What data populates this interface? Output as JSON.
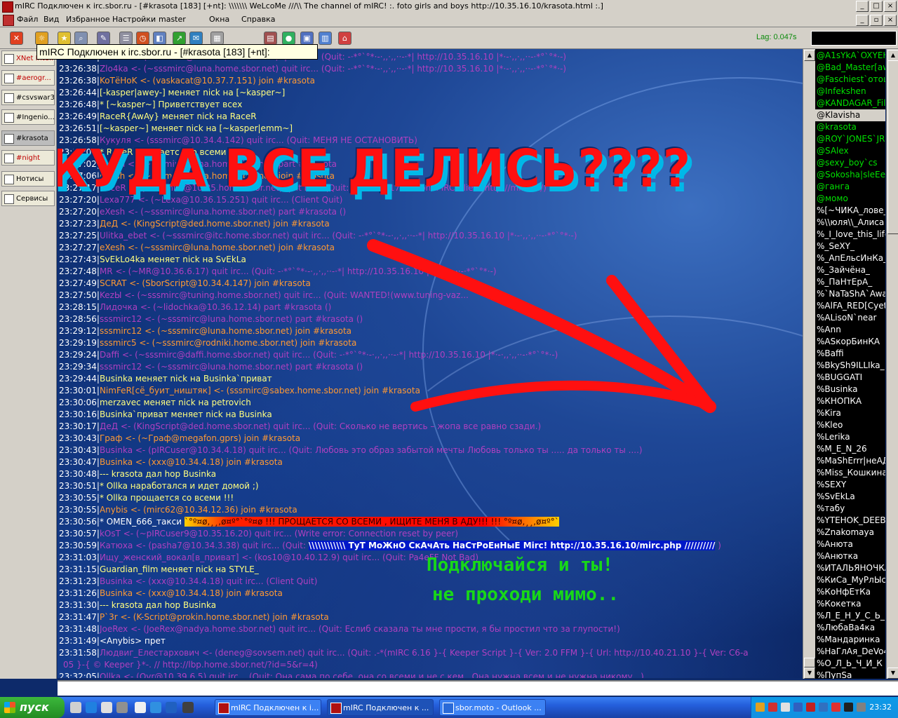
{
  "window": {
    "title": "mIRC Подключен к irc.sbor.ru - [#krasota [183] [+nt]: \\\\\\\\\\\\\\ WeLcoMe ///\\\\ The channel of mIRC! :. foto girls and boys http://10.35.16.10/krasota.html :.]",
    "tooltip": "mIRC Подключен к irc.sbor.ru - [#krasota [183] [+nt]:",
    "lag": "Lag: 0.047s"
  },
  "menu": [
    "Файл",
    "Вид",
    "Избранное",
    "Настройки",
    "master",
    "Окна",
    "Справка"
  ],
  "switchbar": [
    {
      "label": "XNet Inte...",
      "color": "#c00000"
    },
    {
      "label": "#aerogr...",
      "color": "#c00000"
    },
    {
      "label": "#csvswar3",
      "color": "#000000"
    },
    {
      "label": "#Ingenio...",
      "color": "#000000"
    },
    {
      "label": "#krasota",
      "color": "#000000"
    },
    {
      "label": "#night",
      "color": "#c00000"
    },
    {
      "label": "Нотисы",
      "color": "#000000"
    },
    {
      "label": "Сервисы",
      "color": "#000000"
    }
  ],
  "chat": [
    {
      "ts": "23:26:36|",
      "segs": [
        {
          "t": "Zlo4ka <- (~sssmirc@luna.home.sbor.net) quit irc... (Quit: -·*°`°*·-·,,·,,··-·*| http://10.35.16.10 |*·-·,,·,,··-·*°`°*·-)",
          "c": "p"
        }
      ]
    },
    {
      "ts": "23:26:38|",
      "segs": [
        {
          "t": "Zlo4ka <- (~sssmirc@luna.home.sbor.net) quit irc... (Quit: -·*°`°*·-·,,·,,··-·*| http://10.35.16.10 |*·-·,,·,,··-·*°`°*·-)",
          "c": "p"
        }
      ]
    },
    {
      "ts": "23:26:38|",
      "segs": [
        {
          "t": "KoTёHoK <- (vaskacat@10.37.7.151) join #krasota",
          "c": "o"
        }
      ]
    },
    {
      "ts": "23:26:44|",
      "segs": [
        {
          "t": "[-kasper|awey-] меняет nick на [~kasper~]",
          "c": "y"
        }
      ]
    },
    {
      "ts": "23:26:48|",
      "segs": [
        {
          "t": "* [~kasper~] Приветствует всех",
          "c": "y"
        }
      ]
    },
    {
      "ts": "23:26:49|",
      "segs": [
        {
          "t": "RaceR{AwAy} меняет nick на RaceR",
          "c": "y"
        }
      ]
    },
    {
      "ts": "23:26:51|",
      "segs": [
        {
          "t": "[~kasper~] меняет nick на [~kasper|emm~]",
          "c": "y"
        }
      ]
    },
    {
      "ts": "23:26:58|",
      "segs": [
        {
          "t": "Кукуля <- (sssmirc@10.34.4.142) quit irc... (Quit: МЕНЯ НЕ ОСТАНОВИТЬ)",
          "c": "p"
        }
      ]
    },
    {
      "ts": "23:27:00|",
      "segs": [
        {
          "t": "* RaceR прощается со всеми !!!",
          "c": "y"
        }
      ]
    },
    {
      "ts": "23:27:02|",
      "segs": [
        {
          "t": "eXesh <- (~sssmirc@luna.home.sbor.net) part #krasota",
          "c": "p"
        }
      ]
    },
    {
      "ts": "23:27:06|",
      "segs": [
        {
          "t": "eXesh <- (~sssmirc@luna.home.sbor.net) join #krasota",
          "c": "o"
        }
      ]
    },
    {
      "ts": "23:27:17|",
      "segs": [
        {
          "t": "RaceR <- (~sssmirc@10.35.home.sbor.net) quit irc... (Quit: mIRC v6.17 Personal IRC Client http://mirc.ru/)",
          "c": "p"
        }
      ]
    },
    {
      "ts": "23:27:20|",
      "segs": [
        {
          "t": "Lexa777 <- (~Lexa@10.36.15.251) quit irc... (Client Quit)",
          "c": "p"
        }
      ]
    },
    {
      "ts": "23:27:20|",
      "segs": [
        {
          "t": "eXesh <- (~sssmirc@luna.home.sbor.net) part #krasota ()",
          "c": "p"
        }
      ]
    },
    {
      "ts": "23:27:23|",
      "segs": [
        {
          "t": "ДеД <- (KingScript@ded.home.sbor.net) join #krasota",
          "c": "o"
        }
      ]
    },
    {
      "ts": "23:27:25|",
      "segs": [
        {
          "t": "Ulitka_ebet <- (~sssmirc@itc.home.sbor.net) quit irc... (Quit: -·*°`°*·-·,,·,,··-·*| http://10.35.16.10 |*·-·,,·,,··-·*°`°*·-)",
          "c": "p"
        }
      ]
    },
    {
      "ts": "23:27:27|",
      "segs": [
        {
          "t": "eXesh <- (~sssmirc@luna.home.sbor.net) join #krasota",
          "c": "o"
        }
      ]
    },
    {
      "ts": "23:27:43|",
      "segs": [
        {
          "t": "SvEkLo4ka меняет nick на SvEkLa",
          "c": "y"
        }
      ]
    },
    {
      "ts": "23:27:48|",
      "segs": [
        {
          "t": "MR <- (~MR@10.36.6.17) quit irc... (Quit: -·*°`°*·-·,,·,,··-·*| http://10.35.16.10 |*·-·,,·,,··-·*°`°*·-)",
          "c": "p"
        }
      ]
    },
    {
      "ts": "23:27:49|",
      "segs": [
        {
          "t": "SCRAT <- (SborScript@10.34.4.147) join #krasota",
          "c": "o"
        }
      ]
    },
    {
      "ts": "23:27:50|",
      "segs": [
        {
          "t": "KezЫ <- (~sssmirc@tuning.home.sbor.net) quit irc... (Quit: WANTED!(www.tuning-vaz...",
          "c": "p"
        }
      ]
    },
    {
      "ts": "23:28:15|",
      "segs": [
        {
          "t": "Лидочка <- (~lidochka@10.36.12.14) part #krasota ()",
          "c": "p"
        }
      ]
    },
    {
      "ts": "23:28:56|",
      "segs": [
        {
          "t": "sssmirc12 <- (~sssmirc@luna.home.sbor.net) part #krasota ()",
          "c": "p"
        }
      ]
    },
    {
      "ts": "23:29:12|",
      "segs": [
        {
          "t": "sssmirc12 <- (~sssmirc@luna.home.sbor.net) join #krasota",
          "c": "o"
        }
      ]
    },
    {
      "ts": "23:29:19|",
      "segs": [
        {
          "t": "sssmirc5 <- (~sssmirc@rodniki.home.sbor.net) join #krasota",
          "c": "o"
        }
      ]
    },
    {
      "ts": "23:29:24|",
      "segs": [
        {
          "t": "Daffi <- (~sssmirc@daffi.home.sbor.net) quit irc... (Quit: -·*°`°*·-·,,·,,··-·*| http://10.35.16.10 |*·-·,,·,,··-·*°`°*·-)",
          "c": "p"
        }
      ]
    },
    {
      "ts": "23:29:34|",
      "segs": [
        {
          "t": "sssmirc12 <- (~sssmirc@luna.home.sbor.net) part #krasota ()",
          "c": "p"
        }
      ]
    },
    {
      "ts": "23:29:44|",
      "segs": [
        {
          "t": "Businka меняет nick на Businka`приват",
          "c": "y"
        }
      ]
    },
    {
      "ts": "23:30:01|",
      "segs": [
        {
          "t": "NimFeR[cё_буит_ништяк] <- (sssmirc@sabex.home.sbor.net) join #krasota",
          "c": "o"
        }
      ]
    },
    {
      "ts": "23:30:06|",
      "segs": [
        {
          "t": "merzavec меняет nick на petrovich",
          "c": "y"
        }
      ]
    },
    {
      "ts": "23:30:16|",
      "segs": [
        {
          "t": "Businka`приват меняет nick на Businka",
          "c": "y"
        }
      ]
    },
    {
      "ts": "23:30:17|",
      "segs": [
        {
          "t": "ДеД <- (KingScript@ded.home.sbor.net) quit irc... (Quit: Сколько не вертись – жопа все равно сзади.)",
          "c": "p"
        }
      ]
    },
    {
      "ts": "23:30:43|",
      "segs": [
        {
          "t": "Граф <- (~Граф@megafon.gprs) join #krasota",
          "c": "o"
        }
      ]
    },
    {
      "ts": "23:30:43|",
      "segs": [
        {
          "t": "Businka <- (pIRCuser@10.34.4.18) quit irc... (Quit: Любовь это образ забытой мечты Любовь только ты ..... да только ты ....)",
          "c": "p"
        }
      ]
    },
    {
      "ts": "23:30:47|",
      "segs": [
        {
          "t": "Businka <- (xxx@10.34.4.18) join #krasota",
          "c": "o"
        }
      ]
    },
    {
      "ts": "23:30:48|",
      "segs": [
        {
          "t": "--- krasota дал hop Businka",
          "c": "y"
        }
      ]
    },
    {
      "ts": "23:30:51|",
      "segs": [
        {
          "t": "* Ollka наработался и идет домой ;)",
          "c": "y"
        }
      ]
    },
    {
      "ts": "23:30:55|",
      "segs": [
        {
          "t": "* Ollka прощается со всеми !!!",
          "c": "y"
        }
      ]
    },
    {
      "ts": "23:30:55|",
      "segs": [
        {
          "t": "Anybis <- (mirc62@10.34.12.36) join #krasota",
          "c": "o"
        }
      ]
    },
    {
      "ts": "23:30:56|",
      "segs": [
        {
          "t": "* OMEN_666_такси ",
          "c": "w"
        },
        {
          "t": "`°º¤ø,¸¸,ø¤º°`°º¤ø !!! ПРОЩАЕТСЯ СО ВСЕМИ , ИЩИТЕ МЕНЯ В АДУ!!! !!! °º¤ø,¸¸,ø¤º°`",
          "c": "hl"
        }
      ]
    },
    {
      "ts": "23:30:57|",
      "segs": [
        {
          "t": "kOsT <- (~pIRCuser9@10.35.16.20) quit irc... (Write error: Connection reset by peer)",
          "c": "p"
        }
      ]
    },
    {
      "ts": "23:30:59|",
      "segs": [
        {
          "t": "Катюха <- (pasha7@10.34.3.38) quit irc... (Quit: ",
          "c": "p"
        },
        {
          "t": "\\\\\\\\\\\\\\\\\\\\\\\\  ТуТ МоЖнО СкАчАть НаСтРоЕнНыЕ Mirc! http://10.35.16.10/mirc.php  //////////",
          "c": "bar"
        },
        {
          "t": " )",
          "c": "p"
        }
      ]
    },
    {
      "ts": "23:31:03|",
      "segs": [
        {
          "t": "Ищу_женский_вокал[в_приват] <- (kos10@10.40.12.9) quit irc... (Quit: Pa4eFF Not Bad)",
          "c": "p"
        }
      ]
    },
    {
      "ts": "23:31:15|",
      "segs": [
        {
          "t": "Guardian_film меняет nick на STYLE_",
          "c": "y"
        }
      ]
    },
    {
      "ts": "23:31:23|",
      "segs": [
        {
          "t": "Businka <- (xxx@10.34.4.18) quit irc... (Client Quit)",
          "c": "p"
        }
      ]
    },
    {
      "ts": "23:31:26|",
      "segs": [
        {
          "t": "Businka <- (xxx@10.34.4.18) join #krasota",
          "c": "o"
        }
      ]
    },
    {
      "ts": "23:31:30|",
      "segs": [
        {
          "t": "--- krasota дал hop Businka",
          "c": "y"
        }
      ]
    },
    {
      "ts": "23:31:47|",
      "segs": [
        {
          "t": "P`3r <- (K-Script@prokin.home.sbor.net) join #krasota",
          "c": "o"
        }
      ]
    },
    {
      "ts": "23:31:48|",
      "segs": [
        {
          "t": "JoeRex <- (JoeRex@nadya.home.sbor.net) quit irc... (Quit: Еслиб сказала ты мне прости, я бы простил что за глупости!)",
          "c": "p"
        }
      ]
    },
    {
      "ts": "23:31:49|",
      "segs": [
        {
          "t": "<Anybis> прет",
          "c": "w"
        }
      ]
    },
    {
      "ts": "23:31:58|",
      "segs": [
        {
          "t": "Людвиг_Елестархович <- (deneg@sovsem.net) quit irc... (Quit: .-*(mIRC 6.16 }-{ Keeper Script }-{ Ver: 2.0 FFM }-{ Url: http://10.40.21.10 }-{ Ver: C6-a",
          "c": "p"
        }
      ]
    },
    {
      "ts": "",
      "segs": [
        {
          "t": "05 }-{ © Keeper }*-. // http://lbp.home.sbor.net/?id=5&r=4)",
          "c": "p"
        }
      ]
    },
    {
      "ts": "23:32:05|",
      "segs": [
        {
          "t": "Ollka <- (Ovr@10.39.6.5) quit irc... (Quit: Она сама по себе, она со всеми и не с кем...Она нужна всем и не нужна никому...)",
          "c": "p"
        }
      ]
    }
  ],
  "overlay": {
    "headline": "КУДА ВСЕ ДЕЛИСЬ????",
    "promo_line1": "Подключайся и ты!",
    "promo_line2": "не проходи мимо.."
  },
  "nicklist": [
    {
      "nick": "@A1sYkA`OXYEH",
      "op": true
    },
    {
      "nick": "@Bad_Master[away]",
      "op": true
    },
    {
      "nick": "@Faschiest`отошел",
      "op": true
    },
    {
      "nick": "@Infekshen",
      "op": true
    },
    {
      "nick": "@KANDAGAR_FiltR",
      "op": true
    },
    {
      "nick": "@Klavisha",
      "op": true,
      "sel": true
    },
    {
      "nick": "@krasota",
      "op": true
    },
    {
      "nick": "@ROY`JONES`JR",
      "op": true
    },
    {
      "nick": "@SAlex",
      "op": true
    },
    {
      "nick": "@sexy_boy`cs",
      "op": true
    },
    {
      "nick": "@Sokosha|sleEeEp",
      "op": true
    },
    {
      "nick": "@ганга",
      "op": true
    },
    {
      "nick": "@момо",
      "op": true
    },
    {
      "nick": "%[~ЧИКА_лове_тебя]",
      "op": false
    },
    {
      "nick": "%\\\\юля\\\\_Алиса",
      "op": false
    },
    {
      "nick": "%_I_love_this_life",
      "op": false
    },
    {
      "nick": "%_SeXY_",
      "op": false
    },
    {
      "nick": "%_АпЕльсИнКа_",
      "op": false
    },
    {
      "nick": "%_Зайчёна_",
      "op": false
    },
    {
      "nick": "%_ПаНтЕрА_",
      "op": false
    },
    {
      "nick": "%`NaTaShA`Away",
      "op": false
    },
    {
      "nick": "%AlFA_RED[Cyeta]",
      "op": false
    },
    {
      "nick": "%ALisoN`near",
      "op": false
    },
    {
      "nick": "%Ann",
      "op": false
    },
    {
      "nick": "%ASкорБинКА",
      "op": false
    },
    {
      "nick": "%Baffi",
      "op": false
    },
    {
      "nick": "%BkySh9ILLIka_",
      "op": false
    },
    {
      "nick": "%BUGGATI",
      "op": false
    },
    {
      "nick": "%Businka",
      "op": false
    },
    {
      "nick": "%КНОПКА",
      "op": false
    },
    {
      "nick": "%Kira",
      "op": false
    },
    {
      "nick": "%Kleo",
      "op": false
    },
    {
      "nick": "%Lerika",
      "op": false
    },
    {
      "nick": "%M_E_N_26",
      "op": false
    },
    {
      "nick": "%MaShErrr|неАДЕКВАТ",
      "op": false
    },
    {
      "nick": "%Miss_Кошкина",
      "op": false
    },
    {
      "nick": "%SEXY",
      "op": false
    },
    {
      "nick": "%SvEkLa",
      "op": false
    },
    {
      "nick": "%табу",
      "op": false
    },
    {
      "nick": "%YTEHOK_DEEBOU",
      "op": false
    },
    {
      "nick": "%Znakomaya",
      "op": false
    },
    {
      "nick": "%Анюта",
      "op": false
    },
    {
      "nick": "%Анютка",
      "op": false
    },
    {
      "nick": "%ИТАЛЬЯНОЧКА",
      "op": false
    },
    {
      "nick": "%КиСа_МуРлЫсА",
      "op": false
    },
    {
      "nick": "%КоНфЕтКа",
      "op": false
    },
    {
      "nick": "%Кокетка",
      "op": false
    },
    {
      "nick": "%Л_Е_Н_У_С_Ь_К_А",
      "op": false
    },
    {
      "nick": "%ЛюбаВа4ка",
      "op": false
    },
    {
      "nick": "%Мандаринка",
      "op": false
    },
    {
      "nick": "%НаГлАя_DeVo4Ka",
      "op": false
    },
    {
      "nick": "%О_Л_Ь_Ч_И_К",
      "op": false
    },
    {
      "nick": "%ПупSа",
      "op": false
    }
  ],
  "taskbar": {
    "start": "пуск",
    "tasks": [
      "mIRC Подключен к i...",
      "mIRC Подключен к ...",
      "sbor.moto - Outlook ..."
    ],
    "clock": "23:32"
  },
  "colors": {
    "op_nick": "#00e000",
    "voice_nick": "#ffffff",
    "join": "#ff9933",
    "quit": "#b040c0",
    "nickchange": "#ffff7f",
    "headline": "#ff1010",
    "promo": "#18d818"
  }
}
